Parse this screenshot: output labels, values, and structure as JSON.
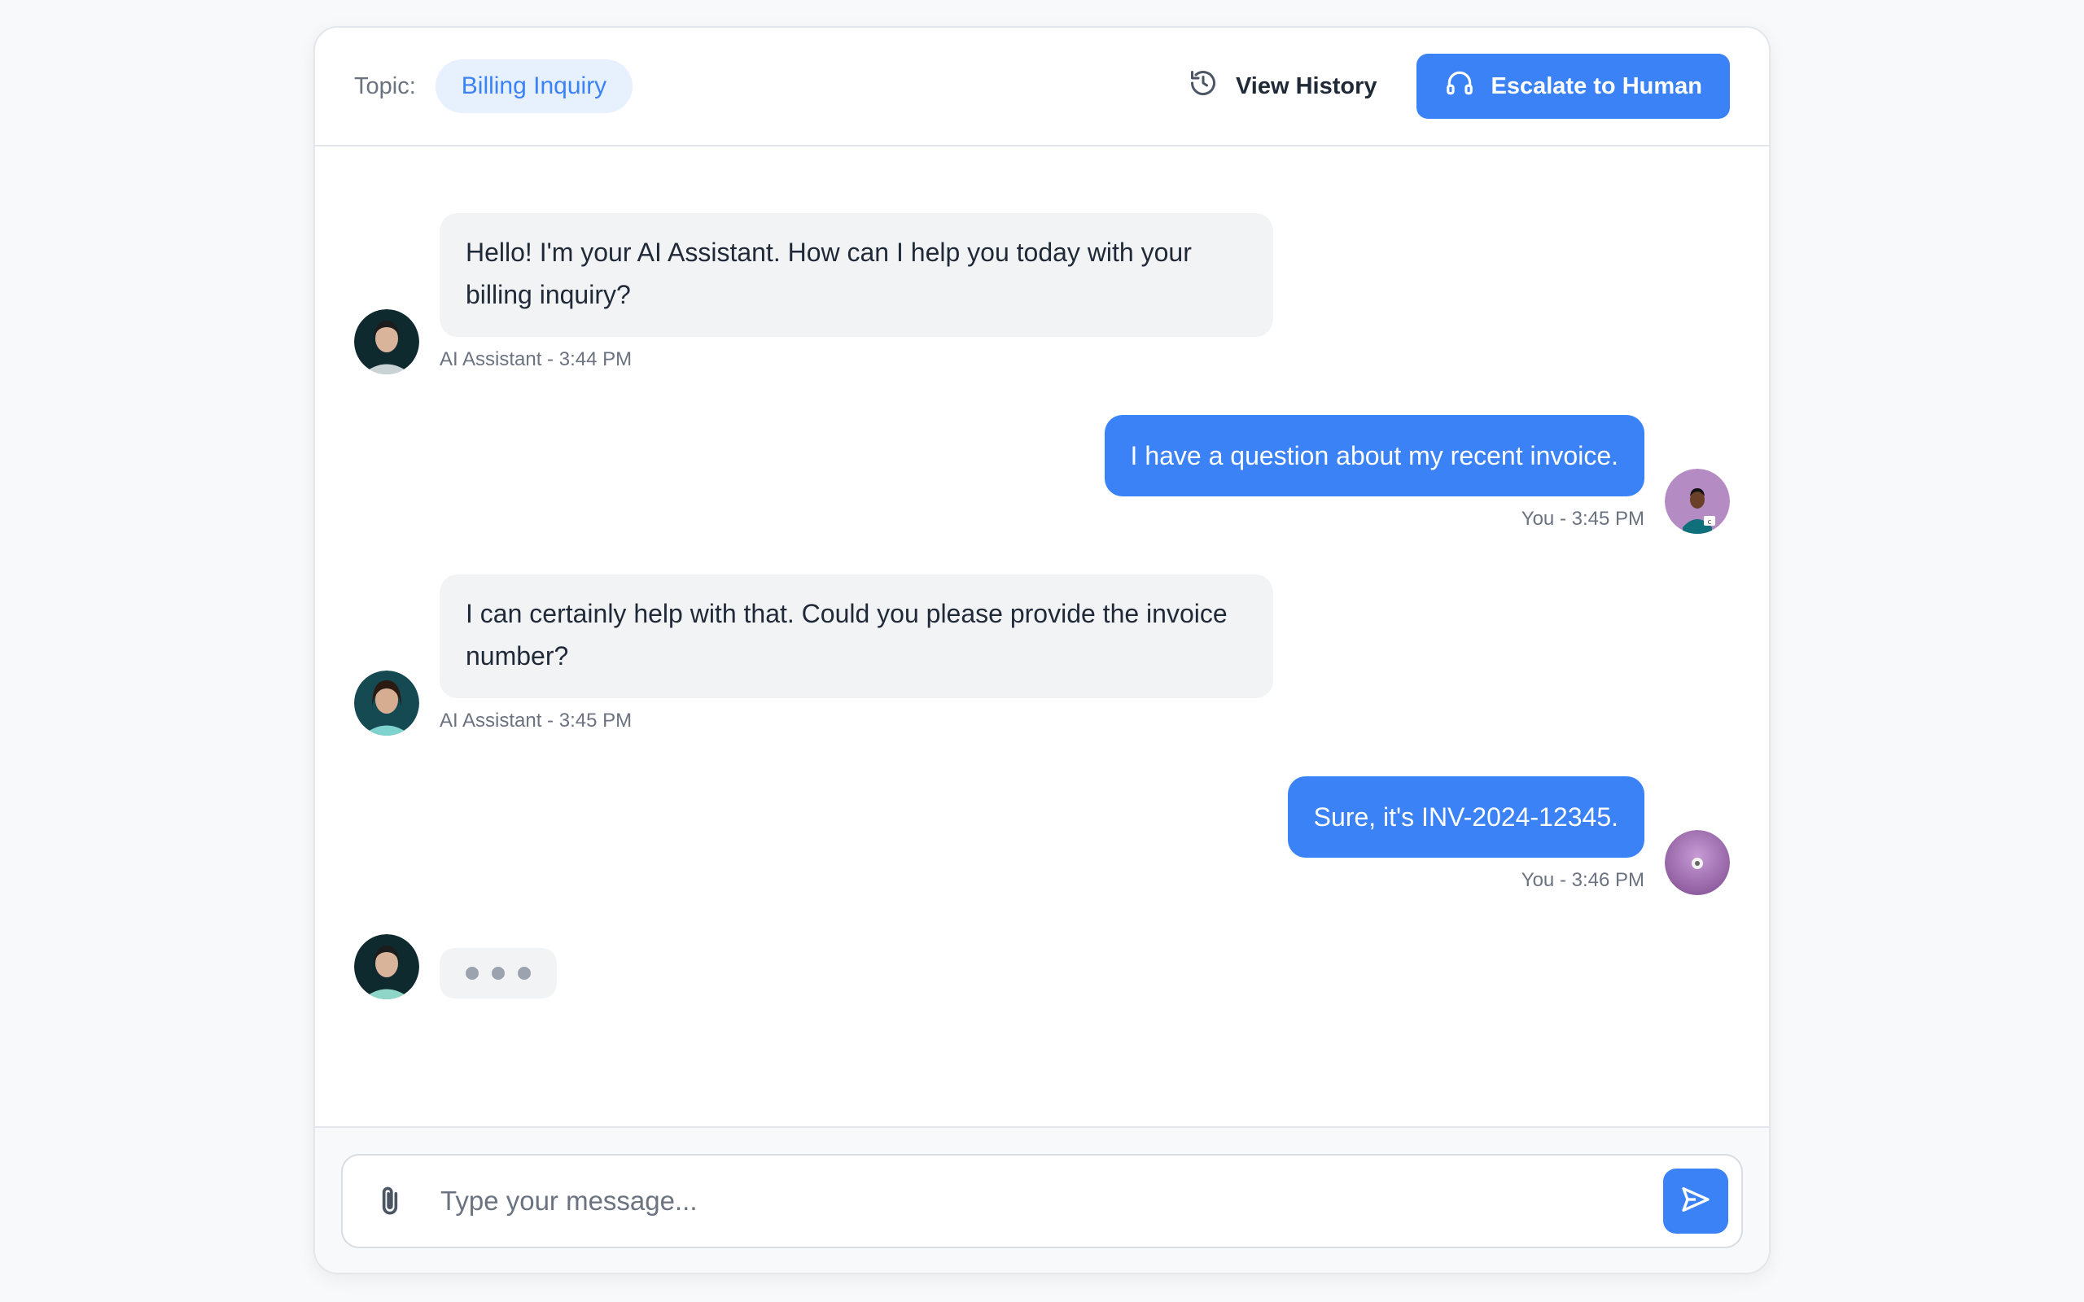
{
  "header": {
    "topic_label": "Topic:",
    "topic_value": "Billing Inquiry",
    "history_label": "View History",
    "escalate_label": "Escalate to Human"
  },
  "messages": [
    {
      "sender": "ai",
      "text": "Hello! I'm your AI Assistant. How can I help you today with your billing inquiry?",
      "meta": "AI Assistant - 3:44 PM"
    },
    {
      "sender": "user",
      "text": "I have a question about my recent invoice.",
      "meta": "You - 3:45 PM"
    },
    {
      "sender": "ai",
      "text": "I can certainly help with that. Could you please provide the invoice number?",
      "meta": "AI Assistant - 3:45 PM"
    },
    {
      "sender": "user",
      "text": "Sure, it's INV-2024-12345.",
      "meta": "You - 3:46 PM"
    }
  ],
  "composer": {
    "placeholder": "Type your message...",
    "value": ""
  },
  "colors": {
    "accent": "#3b82f6",
    "chip_bg": "#e7f0fd",
    "ai_bubble": "#f2f3f5",
    "user_avatar_bg": "#b58bc4"
  },
  "icons": {
    "history": "history-icon",
    "escalate": "headset-icon",
    "attach": "paperclip-icon",
    "send": "send-icon"
  }
}
